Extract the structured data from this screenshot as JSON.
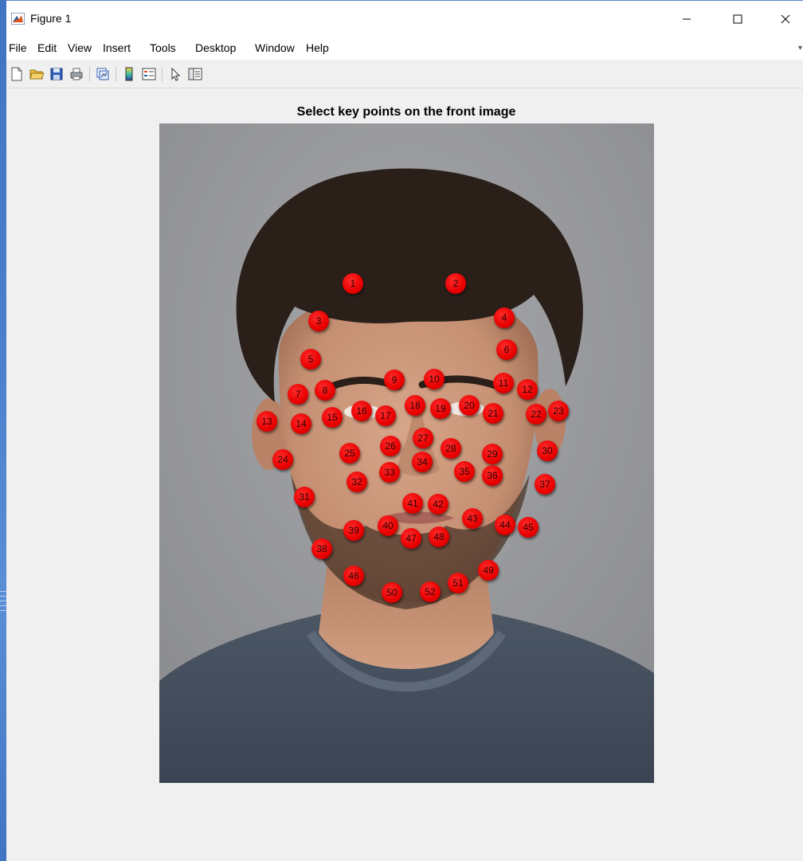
{
  "window": {
    "title": "Figure 1",
    "controls": {
      "minimize": "—",
      "maximize": "☐",
      "close": "✕"
    }
  },
  "menubar": {
    "items": [
      "File",
      "Edit",
      "View",
      "Insert",
      "Tools",
      "Desktop",
      "Window",
      "Help"
    ]
  },
  "toolbar": {
    "buttons": [
      "new-figure-icon",
      "open-file-icon",
      "save-icon",
      "print-icon",
      "link-plot-icon",
      "colorbar-icon",
      "legend-icon",
      "edit-plot-pointer-icon",
      "property-inspector-icon"
    ]
  },
  "axes": {
    "title": "Select key points on the front image"
  },
  "keypoints": {
    "color": "#e80000",
    "labels": [
      "1",
      "2",
      "3",
      "4",
      "5",
      "6",
      "7",
      "8",
      "9",
      "10",
      "11",
      "12",
      "13",
      "14",
      "15",
      "16",
      "17",
      "18",
      "19",
      "20",
      "21",
      "22",
      "23",
      "24",
      "25",
      "26",
      "27",
      "28",
      "29",
      "30",
      "31",
      "32",
      "33",
      "34",
      "35",
      "36",
      "37",
      "38",
      "39",
      "40",
      "41",
      "42",
      "43",
      "44",
      "45",
      "46",
      "47",
      "48",
      "49",
      "50",
      "51",
      "52"
    ]
  }
}
